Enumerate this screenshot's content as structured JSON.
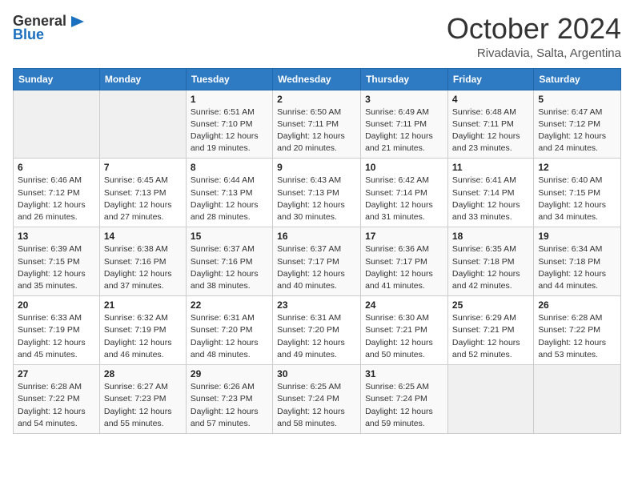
{
  "logo": {
    "text_general": "General",
    "text_blue": "Blue",
    "icon": "▶"
  },
  "title": "October 2024",
  "subtitle": "Rivadavia, Salta, Argentina",
  "days_of_week": [
    "Sunday",
    "Monday",
    "Tuesday",
    "Wednesday",
    "Thursday",
    "Friday",
    "Saturday"
  ],
  "weeks": [
    [
      {
        "day": "",
        "empty": true
      },
      {
        "day": "",
        "empty": true
      },
      {
        "day": "1",
        "sunrise": "Sunrise: 6:51 AM",
        "sunset": "Sunset: 7:10 PM",
        "daylight": "Daylight: 12 hours and 19 minutes."
      },
      {
        "day": "2",
        "sunrise": "Sunrise: 6:50 AM",
        "sunset": "Sunset: 7:11 PM",
        "daylight": "Daylight: 12 hours and 20 minutes."
      },
      {
        "day": "3",
        "sunrise": "Sunrise: 6:49 AM",
        "sunset": "Sunset: 7:11 PM",
        "daylight": "Daylight: 12 hours and 21 minutes."
      },
      {
        "day": "4",
        "sunrise": "Sunrise: 6:48 AM",
        "sunset": "Sunset: 7:11 PM",
        "daylight": "Daylight: 12 hours and 23 minutes."
      },
      {
        "day": "5",
        "sunrise": "Sunrise: 6:47 AM",
        "sunset": "Sunset: 7:12 PM",
        "daylight": "Daylight: 12 hours and 24 minutes."
      }
    ],
    [
      {
        "day": "6",
        "sunrise": "Sunrise: 6:46 AM",
        "sunset": "Sunset: 7:12 PM",
        "daylight": "Daylight: 12 hours and 26 minutes."
      },
      {
        "day": "7",
        "sunrise": "Sunrise: 6:45 AM",
        "sunset": "Sunset: 7:13 PM",
        "daylight": "Daylight: 12 hours and 27 minutes."
      },
      {
        "day": "8",
        "sunrise": "Sunrise: 6:44 AM",
        "sunset": "Sunset: 7:13 PM",
        "daylight": "Daylight: 12 hours and 28 minutes."
      },
      {
        "day": "9",
        "sunrise": "Sunrise: 6:43 AM",
        "sunset": "Sunset: 7:13 PM",
        "daylight": "Daylight: 12 hours and 30 minutes."
      },
      {
        "day": "10",
        "sunrise": "Sunrise: 6:42 AM",
        "sunset": "Sunset: 7:14 PM",
        "daylight": "Daylight: 12 hours and 31 minutes."
      },
      {
        "day": "11",
        "sunrise": "Sunrise: 6:41 AM",
        "sunset": "Sunset: 7:14 PM",
        "daylight": "Daylight: 12 hours and 33 minutes."
      },
      {
        "day": "12",
        "sunrise": "Sunrise: 6:40 AM",
        "sunset": "Sunset: 7:15 PM",
        "daylight": "Daylight: 12 hours and 34 minutes."
      }
    ],
    [
      {
        "day": "13",
        "sunrise": "Sunrise: 6:39 AM",
        "sunset": "Sunset: 7:15 PM",
        "daylight": "Daylight: 12 hours and 35 minutes."
      },
      {
        "day": "14",
        "sunrise": "Sunrise: 6:38 AM",
        "sunset": "Sunset: 7:16 PM",
        "daylight": "Daylight: 12 hours and 37 minutes."
      },
      {
        "day": "15",
        "sunrise": "Sunrise: 6:37 AM",
        "sunset": "Sunset: 7:16 PM",
        "daylight": "Daylight: 12 hours and 38 minutes."
      },
      {
        "day": "16",
        "sunrise": "Sunrise: 6:37 AM",
        "sunset": "Sunset: 7:17 PM",
        "daylight": "Daylight: 12 hours and 40 minutes."
      },
      {
        "day": "17",
        "sunrise": "Sunrise: 6:36 AM",
        "sunset": "Sunset: 7:17 PM",
        "daylight": "Daylight: 12 hours and 41 minutes."
      },
      {
        "day": "18",
        "sunrise": "Sunrise: 6:35 AM",
        "sunset": "Sunset: 7:18 PM",
        "daylight": "Daylight: 12 hours and 42 minutes."
      },
      {
        "day": "19",
        "sunrise": "Sunrise: 6:34 AM",
        "sunset": "Sunset: 7:18 PM",
        "daylight": "Daylight: 12 hours and 44 minutes."
      }
    ],
    [
      {
        "day": "20",
        "sunrise": "Sunrise: 6:33 AM",
        "sunset": "Sunset: 7:19 PM",
        "daylight": "Daylight: 12 hours and 45 minutes."
      },
      {
        "day": "21",
        "sunrise": "Sunrise: 6:32 AM",
        "sunset": "Sunset: 7:19 PM",
        "daylight": "Daylight: 12 hours and 46 minutes."
      },
      {
        "day": "22",
        "sunrise": "Sunrise: 6:31 AM",
        "sunset": "Sunset: 7:20 PM",
        "daylight": "Daylight: 12 hours and 48 minutes."
      },
      {
        "day": "23",
        "sunrise": "Sunrise: 6:31 AM",
        "sunset": "Sunset: 7:20 PM",
        "daylight": "Daylight: 12 hours and 49 minutes."
      },
      {
        "day": "24",
        "sunrise": "Sunrise: 6:30 AM",
        "sunset": "Sunset: 7:21 PM",
        "daylight": "Daylight: 12 hours and 50 minutes."
      },
      {
        "day": "25",
        "sunrise": "Sunrise: 6:29 AM",
        "sunset": "Sunset: 7:21 PM",
        "daylight": "Daylight: 12 hours and 52 minutes."
      },
      {
        "day": "26",
        "sunrise": "Sunrise: 6:28 AM",
        "sunset": "Sunset: 7:22 PM",
        "daylight": "Daylight: 12 hours and 53 minutes."
      }
    ],
    [
      {
        "day": "27",
        "sunrise": "Sunrise: 6:28 AM",
        "sunset": "Sunset: 7:22 PM",
        "daylight": "Daylight: 12 hours and 54 minutes."
      },
      {
        "day": "28",
        "sunrise": "Sunrise: 6:27 AM",
        "sunset": "Sunset: 7:23 PM",
        "daylight": "Daylight: 12 hours and 55 minutes."
      },
      {
        "day": "29",
        "sunrise": "Sunrise: 6:26 AM",
        "sunset": "Sunset: 7:23 PM",
        "daylight": "Daylight: 12 hours and 57 minutes."
      },
      {
        "day": "30",
        "sunrise": "Sunrise: 6:25 AM",
        "sunset": "Sunset: 7:24 PM",
        "daylight": "Daylight: 12 hours and 58 minutes."
      },
      {
        "day": "31",
        "sunrise": "Sunrise: 6:25 AM",
        "sunset": "Sunset: 7:24 PM",
        "daylight": "Daylight: 12 hours and 59 minutes."
      },
      {
        "day": "",
        "empty": true
      },
      {
        "day": "",
        "empty": true
      }
    ]
  ]
}
